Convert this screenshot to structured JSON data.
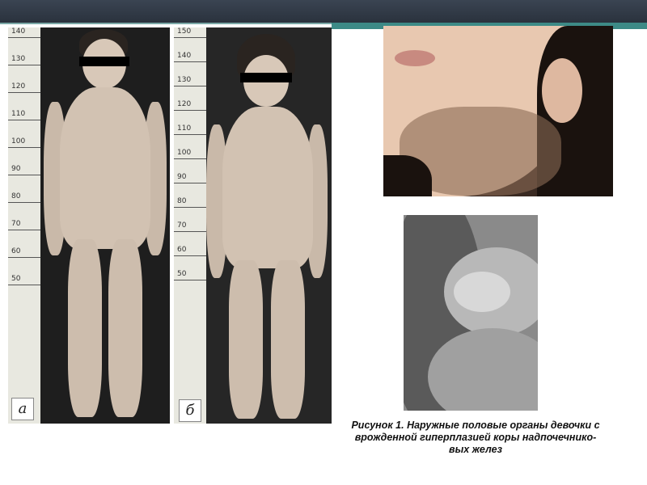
{
  "figure_labels": {
    "a": "а",
    "b": "б"
  },
  "ruler_a": [
    "140",
    "130",
    "120",
    "110",
    "100",
    "90",
    "80",
    "70",
    "60",
    "50"
  ],
  "ruler_b": [
    "150",
    "140",
    "130",
    "120",
    "110",
    "100",
    "90",
    "80",
    "70",
    "60",
    "50"
  ],
  "caption": {
    "line1": "Рисунок 1. Наружные половые органы девочки с",
    "line2": "врожденной гиперплазией коры надпочечнико-",
    "line3": "вых желез"
  },
  "colors": {
    "header": "#2f3844",
    "accent": "#3d8a86"
  }
}
